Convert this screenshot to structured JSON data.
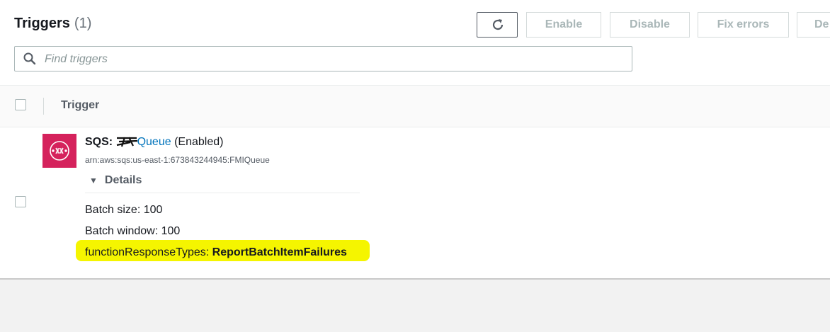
{
  "header": {
    "title": "Triggers",
    "count": "(1)"
  },
  "toolbar": {
    "refresh_icon": "refresh-icon",
    "enable_label": "Enable",
    "disable_label": "Disable",
    "fix_errors_label": "Fix errors",
    "delete_label": "De"
  },
  "search": {
    "placeholder": "Find triggers",
    "value": "",
    "icon": "search-icon"
  },
  "table": {
    "column_header": "Trigger"
  },
  "trigger": {
    "icon": "sqs-icon",
    "service": "SQS:",
    "queue_name_visible": "Queue",
    "status": "(Enabled)",
    "arn": "arn:aws:sqs:us-east-1:673843244945:FMIQueue",
    "details_label": "Details",
    "batch_size_label": "Batch size:",
    "batch_size_value": "100",
    "batch_window_label": "Batch window:",
    "batch_window_value": "100",
    "function_response_label": "functionResponseTypes:",
    "function_response_value": "ReportBatchItemFailures"
  },
  "colors": {
    "sqs_icon": "#d5225c",
    "link": "#0073bb",
    "highlight": "#f5f500"
  }
}
